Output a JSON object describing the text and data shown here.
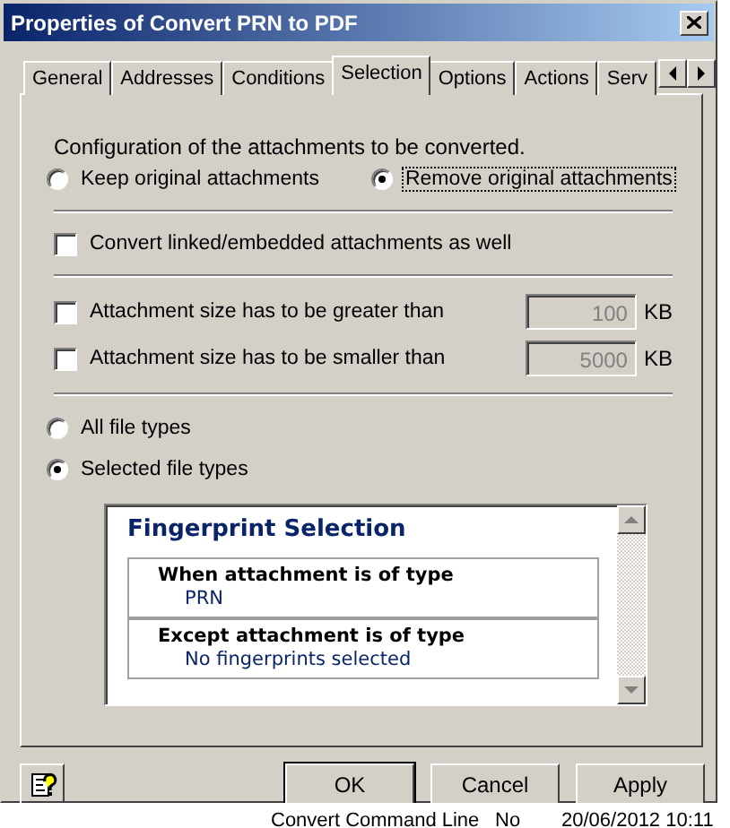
{
  "window": {
    "title": "Properties of Convert PRN to PDF"
  },
  "tabs": [
    {
      "label": "General",
      "selected": false
    },
    {
      "label": "Addresses",
      "selected": false
    },
    {
      "label": "Conditions",
      "selected": false
    },
    {
      "label": "Selection",
      "selected": true
    },
    {
      "label": "Options",
      "selected": false
    },
    {
      "label": "Actions",
      "selected": false
    },
    {
      "label": "Serv",
      "selected": false
    }
  ],
  "configuration": {
    "label": "Configuration of the attachments to be converted.",
    "options": [
      {
        "label": "Keep original attachments",
        "selected": false
      },
      {
        "label": "Remove original attachments",
        "selected": true
      }
    ]
  },
  "convert_linked": {
    "label": "Convert linked/embedded attachments as well",
    "checked": false
  },
  "size_limits": [
    {
      "label": "Attachment size has to be greater than",
      "checked": false,
      "value": "100",
      "unit": "KB",
      "disabled": true
    },
    {
      "label": "Attachment size has to be smaller than",
      "checked": false,
      "value": "5000",
      "unit": "KB",
      "disabled": true
    }
  ],
  "file_types": [
    {
      "label": "All file types",
      "selected": false
    },
    {
      "label": "Selected file types",
      "selected": true
    }
  ],
  "fingerprint": {
    "title": "Fingerprint Selection",
    "rules": [
      {
        "heading": "When attachment is of type",
        "value": "PRN"
      },
      {
        "heading": "Except attachment is of type",
        "value": "No fingerprints selected"
      }
    ]
  },
  "buttons": [
    {
      "label": "OK",
      "default": true
    },
    {
      "label": "Cancel",
      "default": false
    },
    {
      "label": "Apply",
      "default": false
    }
  ],
  "background_row": [
    "Convert Command Line",
    "No",
    "20/06/2012 10:11"
  ]
}
